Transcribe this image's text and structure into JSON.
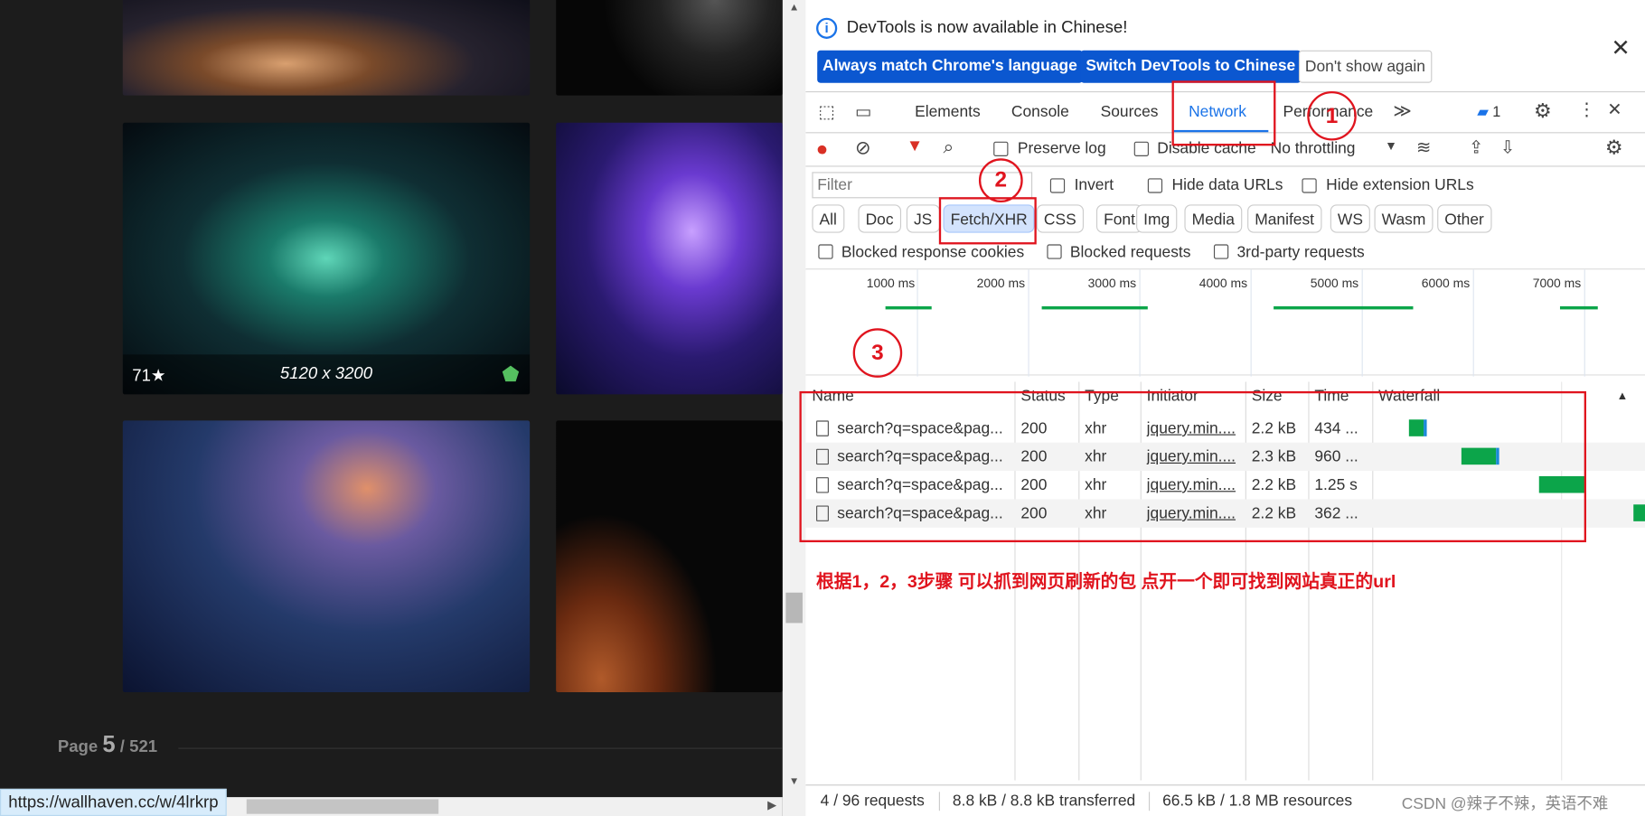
{
  "left_page": {
    "thumb": {
      "favorites": "71",
      "resolution": "5120 x 3200"
    },
    "pager": {
      "label": "Page",
      "current": "5",
      "total": "/ 521"
    },
    "status_url": "https://wallhaven.cc/w/4lrkrp"
  },
  "devtools": {
    "infobar": {
      "message": "DevTools is now available in Chinese!",
      "match_button": "Always match Chrome's language",
      "switch_button": "Switch DevTools to Chinese",
      "dismiss_button": "Don't show again"
    },
    "tabs": [
      {
        "label": "Elements"
      },
      {
        "label": "Console"
      },
      {
        "label": "Sources"
      },
      {
        "label": "Network",
        "active": true
      },
      {
        "label": "Performance"
      }
    ],
    "issues_count": "1",
    "toolbar": {
      "preserve_log": "Preserve log",
      "disable_cache": "Disable cache",
      "throttling": "No throttling"
    },
    "filter": {
      "placeholder": "Filter",
      "invert": "Invert",
      "hide_data_urls": "Hide data URLs",
      "hide_extension_urls": "Hide extension URLs"
    },
    "type_filters": [
      "All",
      "Doc",
      "JS",
      "Fetch/XHR",
      "CSS",
      "Font",
      "Img",
      "Media",
      "Manifest",
      "WS",
      "Wasm",
      "Other"
    ],
    "selected_filter": "Fetch/XHR",
    "blocked": {
      "response_cookies": "Blocked response cookies",
      "requests": "Blocked requests",
      "third_party": "3rd-party requests"
    },
    "overview_ticks": [
      "1000 ms",
      "2000 ms",
      "3000 ms",
      "4000 ms",
      "5000 ms",
      "6000 ms",
      "7000 ms"
    ],
    "columns": [
      "Name",
      "Status",
      "Type",
      "Initiator",
      "Size",
      "Time",
      "Waterfall"
    ],
    "requests": [
      {
        "name": "search?q=space&pag...",
        "status": "200",
        "type": "xhr",
        "initiator": "jquery.min....",
        "size": "2.2 kB",
        "time": "434 ..."
      },
      {
        "name": "search?q=space&pag...",
        "status": "200",
        "type": "xhr",
        "initiator": "jquery.min....",
        "size": "2.3 kB",
        "time": "960 ..."
      },
      {
        "name": "search?q=space&pag...",
        "status": "200",
        "type": "xhr",
        "initiator": "jquery.min....",
        "size": "2.2 kB",
        "time": "1.25 s"
      },
      {
        "name": "search?q=space&pag...",
        "status": "200",
        "type": "xhr",
        "initiator": "jquery.min....",
        "size": "2.2 kB",
        "time": "362 ..."
      }
    ],
    "footer": {
      "requests": "4 / 96 requests",
      "transferred": "8.8 kB / 8.8 kB transferred",
      "resources": "66.5 kB / 1.8 MB resources"
    }
  },
  "annotations": {
    "step1": "1",
    "step2": "2",
    "step3": "3",
    "note": "根据1，2，3步骤 可以抓到网页刷新的包 点开一个即可找到网站真正的url",
    "watermark": "CSDN @辣子不辣，英语不难"
  },
  "colors": {
    "accent": "#1a73e8",
    "annotation": "#e0141e",
    "waterfall": "#0ca54a",
    "left_bg": "#1c1c1c"
  }
}
